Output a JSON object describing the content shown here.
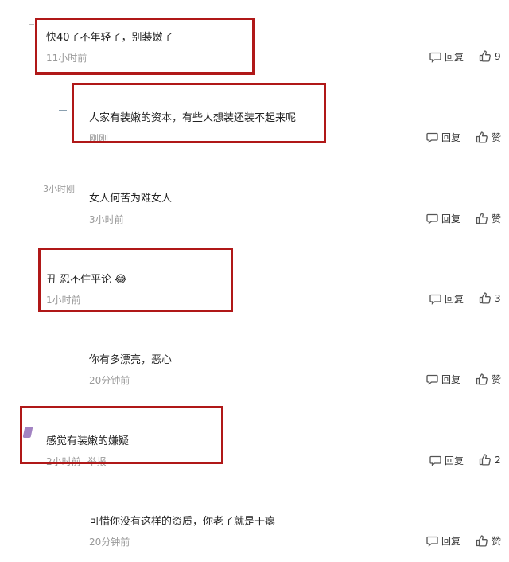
{
  "comments": [
    {
      "text": "快40了不年轻了，别装嫩了",
      "time": "11小时前",
      "reply_label": "回复",
      "like_label": "9"
    },
    {
      "text": "人家有装嫩的资本，有些人想装还装不起来呢",
      "time": "刚刚",
      "reply_label": "回复",
      "like_label": "赞"
    },
    {
      "text": "女人何苦为难女人",
      "time": "3小时前",
      "ghost_label": "3小时刚",
      "reply_label": "回复",
      "like_label": "赞"
    },
    {
      "text": "丑 忍不住平论",
      "emoji": "😂",
      "time": "1小时前",
      "reply_label": "回复",
      "like_label": "3"
    },
    {
      "text": "你有多漂亮，恶心",
      "time": "20分钟前",
      "reply_label": "回复",
      "like_label": "赞"
    },
    {
      "text": "感觉有装嫩的嫌疑",
      "time": "2小时前",
      "extra": "举报",
      "reply_label": "回复",
      "like_label": "2"
    },
    {
      "text": "可惜你没有这样的资质，你老了就是干瘪",
      "time": "20分钟前",
      "reply_label": "回复",
      "like_label": "赞"
    }
  ],
  "colors": {
    "highlight_box": "#b01818",
    "meta_text": "#999999",
    "body_text": "#222222"
  },
  "icons": {
    "reply": "comment-bubble-icon",
    "like": "thumbs-up-icon"
  }
}
